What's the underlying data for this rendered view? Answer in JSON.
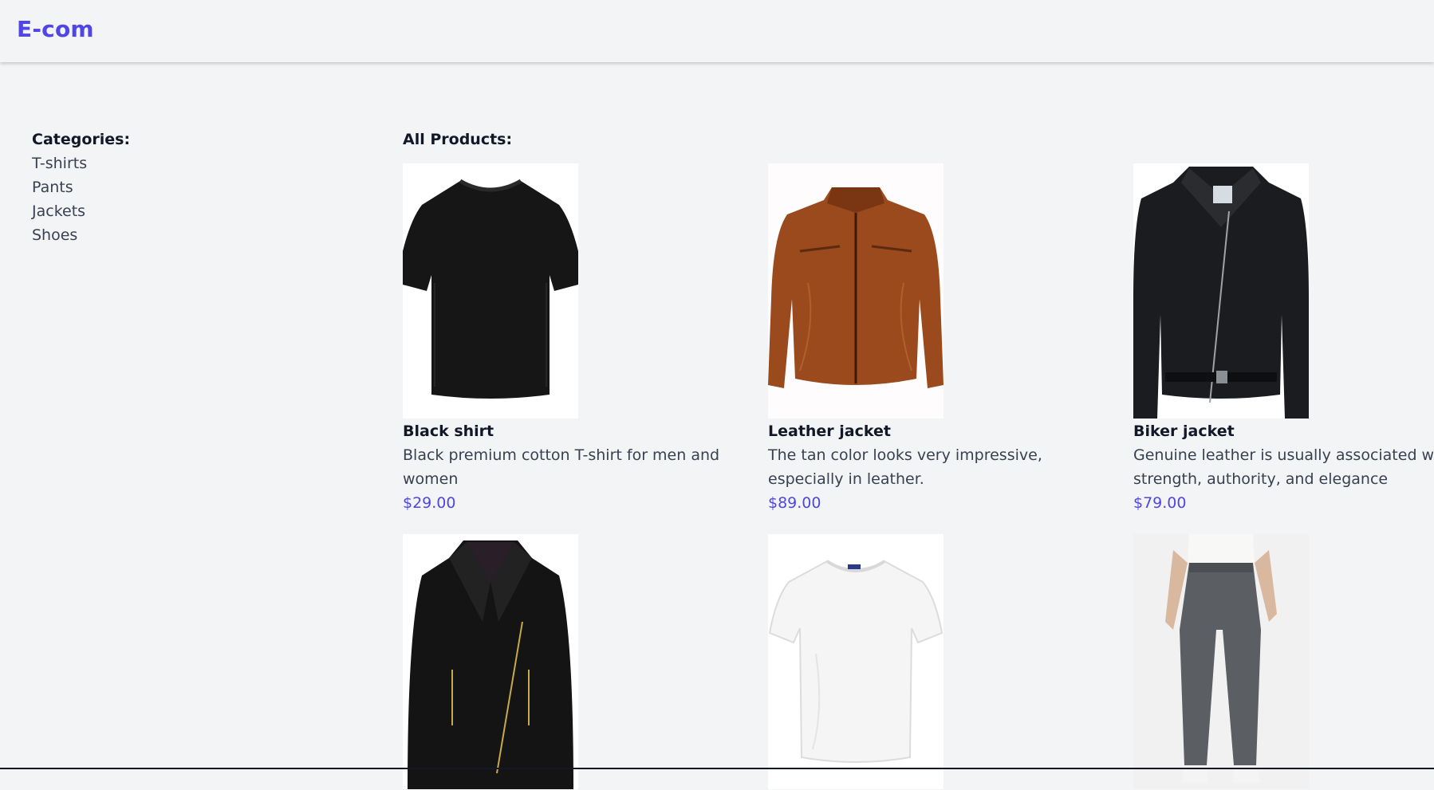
{
  "navbar": {
    "brand": "E-com"
  },
  "sidebar": {
    "title": "Categories:",
    "categories": [
      "T-shirts",
      "Pants",
      "Jackets",
      "Shoes"
    ]
  },
  "main": {
    "title": "All Products:",
    "products": [
      {
        "name": "Black shirt",
        "description": "Black premium cotton T-shirt for men and women",
        "price": "$29.00",
        "image": "black-tshirt"
      },
      {
        "name": "Leather jacket",
        "description": "The tan color looks very impressive, especially in leather.",
        "price": "$89.00",
        "image": "tan-leather-jacket"
      },
      {
        "name": "Biker jacket",
        "description": "Genuine leather is usually associated with strength, authority, and elegance",
        "price": "$79.00",
        "image": "black-biker-jacket"
      },
      {
        "name": "",
        "description": "",
        "price": "",
        "image": "black-womens-leather-jacket"
      },
      {
        "name": "",
        "description": "",
        "price": "",
        "image": "white-tshirt"
      },
      {
        "name": "",
        "description": "",
        "price": "",
        "image": "grey-pants"
      }
    ]
  },
  "colors": {
    "accent": "#4f46e5",
    "background": "#f3f4f6",
    "text": "#111827"
  }
}
